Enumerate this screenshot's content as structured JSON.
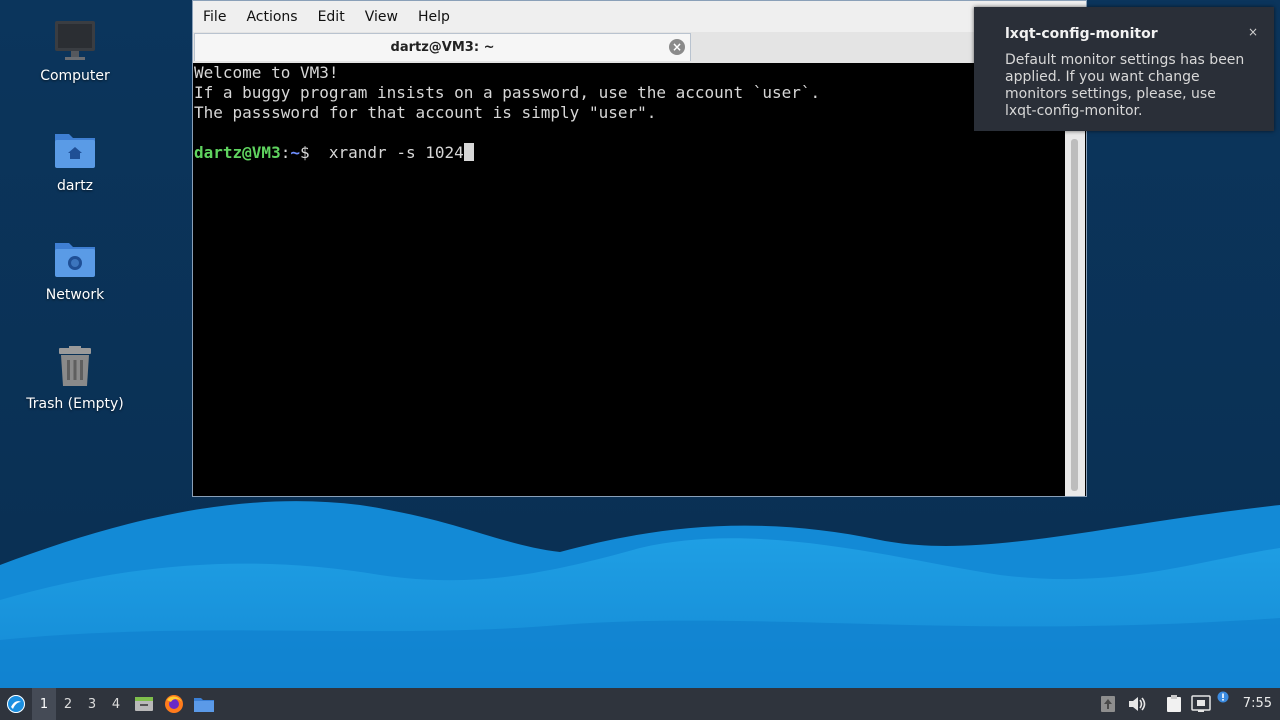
{
  "desktop": {
    "icons": [
      {
        "label": "Computer"
      },
      {
        "label": "dartz"
      },
      {
        "label": "Network"
      },
      {
        "label": "Trash (Empty)"
      }
    ]
  },
  "terminal": {
    "menu": [
      "File",
      "Actions",
      "Edit",
      "View",
      "Help"
    ],
    "tab_title": "dartz@VM3: ~",
    "lines": [
      "Welcome to VM3!",
      "If a buggy program insists on a password, use the account `user`.",
      "The passsword for that account is simply \"user\"."
    ],
    "prompt_user": "dartz@VM3",
    "prompt_sep": ":",
    "prompt_path": "~",
    "prompt_symbol": "$",
    "command": "  xrandr -s 1024"
  },
  "notification": {
    "title": "lxqt-config-monitor",
    "body": "Default monitor settings has been applied. If you want change monitors settings, please, use lxqt-config-monitor.",
    "close": "×"
  },
  "taskbar": {
    "desktops": [
      "1",
      "2",
      "3",
      "4"
    ],
    "active_desktop": "1",
    "clock": "7:55"
  },
  "colors": {
    "wallpaper_dark": "#0b3458",
    "wave_light": "#29a8ea",
    "prompt_user": "#5fd35f",
    "prompt_path": "#6f8fff"
  }
}
